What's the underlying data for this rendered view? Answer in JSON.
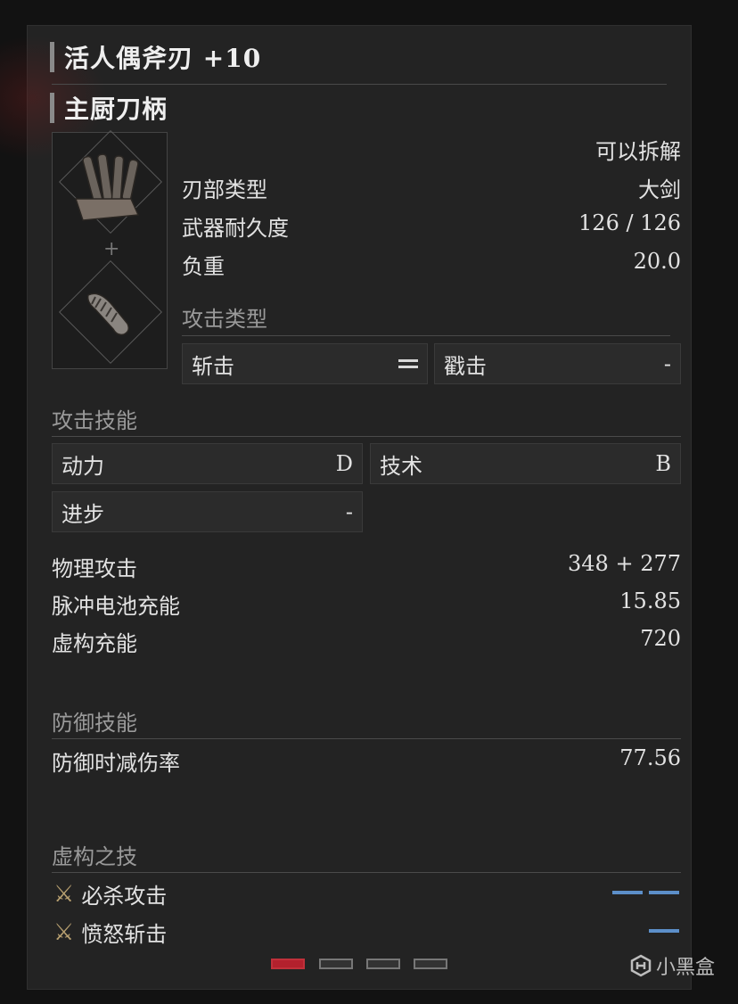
{
  "weapon": {
    "name": "活人偶斧刃 +10",
    "handle": "主厨刀柄",
    "dismantle": "可以拆解",
    "blade_type_label": "刃部类型",
    "blade_type_value": "大剑",
    "durability_label": "武器耐久度",
    "durability_value": "126 / 126",
    "weight_label": "负重",
    "weight_value": "20.0",
    "attack_type_label": "攻击类型",
    "attack_types": [
      {
        "label": "斩击",
        "value": "="
      },
      {
        "label": "戳击",
        "value": "-"
      }
    ]
  },
  "attack_skill": {
    "title": "攻击技能",
    "items": [
      {
        "label": "动力",
        "grade": "D"
      },
      {
        "label": "技术",
        "grade": "B"
      },
      {
        "label": "进步",
        "grade": "-"
      }
    ]
  },
  "stats": [
    {
      "label": "物理攻击",
      "value": "348 + 277"
    },
    {
      "label": "脉冲电池充能",
      "value": "15.85"
    },
    {
      "label": "虚构充能",
      "value": "720"
    }
  ],
  "defense": {
    "title": "防御技能",
    "label": "防御时减伤率",
    "value": "77.56"
  },
  "fable_arts": {
    "title": "虚构之技",
    "items": [
      {
        "label": "必杀攻击",
        "icon": "crossed-swords-icon",
        "segments": 2
      },
      {
        "label": "愤怒斩击",
        "icon": "crossed-swords-icon",
        "segments": 1
      }
    ]
  },
  "pager": {
    "pages": 4,
    "active": 1
  },
  "watermark": "小黑盒",
  "colors": {
    "accent": "#b3212d",
    "segment": "#5c8fc9"
  }
}
